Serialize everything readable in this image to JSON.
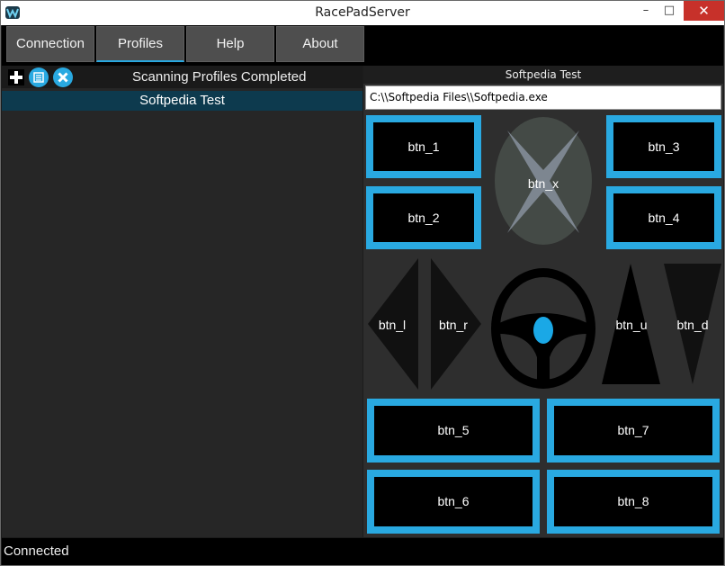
{
  "window": {
    "title": "RacePadServer",
    "min_glyph": "–",
    "max_glyph": "□",
    "close_glyph": "✕"
  },
  "menu": {
    "tabs": [
      "Connection",
      "Profiles",
      "Help",
      "About"
    ],
    "active": "Profiles"
  },
  "left": {
    "status": "Scanning Profiles Completed",
    "profiles": [
      "Softpedia Test"
    ],
    "icons": [
      "add-icon",
      "edit-profile-icon",
      "delete-icon"
    ]
  },
  "right": {
    "profile_name": "Softpedia Test",
    "exe_path": "C:\\\\Softpedia Files\\\\Softpedia.exe",
    "buttons": {
      "btn_1": "btn_1",
      "btn_2": "btn_2",
      "btn_3": "btn_3",
      "btn_4": "btn_4",
      "btn_x": "btn_x",
      "btn_l": "btn_l",
      "btn_r": "btn_r",
      "btn_u": "btn_u",
      "btn_d": "btn_d",
      "btn_5": "btn_5",
      "btn_6": "btn_6",
      "btn_7": "btn_7",
      "btn_8": "btn_8"
    }
  },
  "status": {
    "text": "Connected"
  },
  "colors": {
    "accent": "#29a9e1",
    "background": "#2e2e2e",
    "profile_selected": "#0d3a4e"
  }
}
